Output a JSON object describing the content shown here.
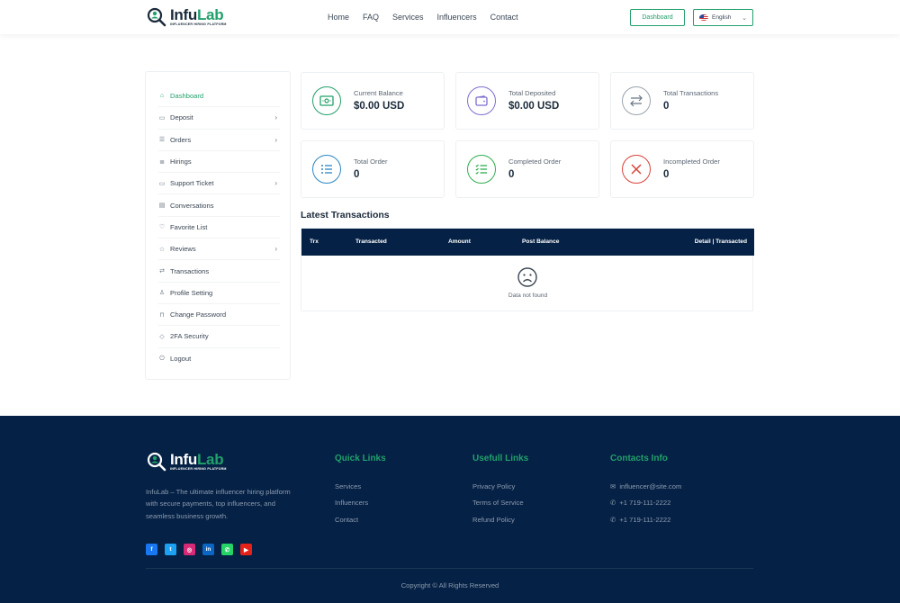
{
  "brand": {
    "name_part1": "Infu",
    "name_part2": "Lab",
    "tagline": "INFLUENCER HIRING PLATFORM",
    "accent": "#22a06b",
    "dark": "#052145"
  },
  "nav": {
    "items": [
      "Home",
      "FAQ",
      "Services",
      "Influencers",
      "Contact"
    ]
  },
  "header": {
    "dashboard_button": "Dashboard",
    "language": "English"
  },
  "sidebar": {
    "items": [
      {
        "label": "Dashboard",
        "icon": "home-icon",
        "active": true,
        "has_arrow": false
      },
      {
        "label": "Deposit",
        "icon": "wallet-icon",
        "has_arrow": true
      },
      {
        "label": "Orders",
        "icon": "list-icon",
        "has_arrow": true
      },
      {
        "label": "Hirings",
        "icon": "checklist-icon",
        "has_arrow": false
      },
      {
        "label": "Support Ticket",
        "icon": "ticket-icon",
        "has_arrow": true
      },
      {
        "label": "Conversations",
        "icon": "chat-icon",
        "has_arrow": false
      },
      {
        "label": "Favorite List",
        "icon": "heart-icon",
        "has_arrow": false
      },
      {
        "label": "Reviews",
        "icon": "star-icon",
        "has_arrow": true
      },
      {
        "label": "Transactions",
        "icon": "transfer-icon",
        "has_arrow": false
      },
      {
        "label": "Profile Setting",
        "icon": "user-icon",
        "has_arrow": false
      },
      {
        "label": "Change Password",
        "icon": "lock-icon",
        "has_arrow": false
      },
      {
        "label": "2FA Security",
        "icon": "shield-icon",
        "has_arrow": false
      },
      {
        "label": "Logout",
        "icon": "logout-icon",
        "has_arrow": false
      }
    ]
  },
  "cards": [
    {
      "label": "Current Balance",
      "value": "$0.00 USD",
      "icon": "money-icon",
      "color": "#22a06b"
    },
    {
      "label": "Total Deposited",
      "value": "$0.00 USD",
      "icon": "wallet-icon",
      "color": "#7b6fd0"
    },
    {
      "label": "Total Transactions",
      "value": "0",
      "icon": "transfer-icon",
      "color": "#6b7683"
    },
    {
      "label": "Total Order",
      "value": "0",
      "icon": "list-icon",
      "color": "#2b86c5"
    },
    {
      "label": "Completed Order",
      "value": "0",
      "icon": "checklist-icon",
      "color": "#2fae4e"
    },
    {
      "label": "Incompleted Order",
      "value": "0",
      "icon": "close-icon",
      "color": "#d9413a"
    }
  ],
  "transactions": {
    "title": "Latest Transactions",
    "columns": [
      "Trx",
      "Transacted",
      "Amount",
      "Post Balance",
      "Detail | Transacted"
    ],
    "empty_text": "Data not found"
  },
  "footer": {
    "description": "InfuLab – The ultimate influencer hiring platform with secure payments, top influencers, and seamless business growth.",
    "quick_links": {
      "title": "Quick Links",
      "items": [
        "Services",
        "Influencers",
        "Contact"
      ]
    },
    "useful_links": {
      "title": "Usefull Links",
      "items": [
        "Privacy Policy",
        "Terms of Service",
        "Refund Policy"
      ]
    },
    "contacts": {
      "title": "Contacts Info",
      "email": "influencer@site.com",
      "phone1": "+1 719-111-2222",
      "phone2": "+1 719-111-2222"
    },
    "socials": [
      {
        "name": "facebook-icon",
        "glyph": "f",
        "color": "#1877f2"
      },
      {
        "name": "twitter-icon",
        "glyph": "t",
        "color": "#1da1f2"
      },
      {
        "name": "instagram-icon",
        "glyph": "◎",
        "color": "#d62976"
      },
      {
        "name": "linkedin-icon",
        "glyph": "in",
        "color": "#0a66c2"
      },
      {
        "name": "whatsapp-icon",
        "glyph": "✆",
        "color": "#25d366"
      },
      {
        "name": "youtube-icon",
        "glyph": "▶",
        "color": "#e62117"
      }
    ],
    "copyright": "Copyright © All Rights Reserved"
  }
}
